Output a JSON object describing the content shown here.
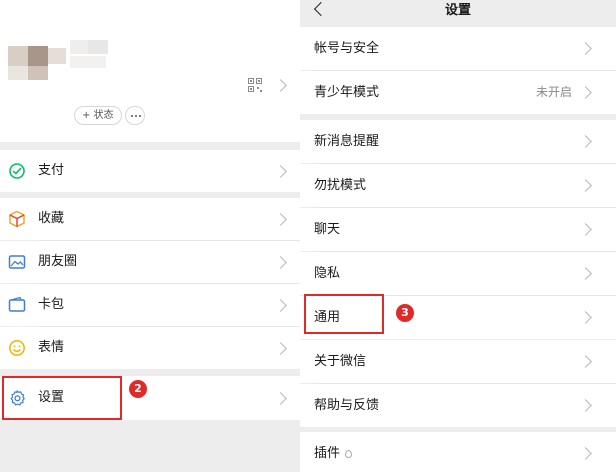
{
  "profile": {
    "status_label": "+ 状态"
  },
  "menu": {
    "items": [
      {
        "label": "支付",
        "icon": "pay-icon"
      },
      {
        "label": "收藏",
        "icon": "favorites-icon"
      },
      {
        "label": "朋友圈",
        "icon": "moments-icon"
      },
      {
        "label": "卡包",
        "icon": "card-wallet-icon"
      },
      {
        "label": "表情",
        "icon": "sticker-icon"
      },
      {
        "label": "设置",
        "icon": "gear-icon"
      }
    ]
  },
  "settings": {
    "title": "设置",
    "items": [
      {
        "label": "帐号与安全"
      },
      {
        "label": "青少年模式",
        "value": "未开启"
      },
      {
        "label": "新消息提醒"
      },
      {
        "label": "勿扰模式"
      },
      {
        "label": "聊天"
      },
      {
        "label": "隐私"
      },
      {
        "label": "通用"
      },
      {
        "label": "关于微信"
      },
      {
        "label": "帮助与反馈"
      },
      {
        "label": "插件"
      }
    ]
  },
  "annotations": {
    "step2": "2",
    "step3": "3"
  },
  "colors": {
    "highlight": "#e02a2a",
    "wechat_green": "#07c160",
    "page_gray": "#ededed"
  }
}
